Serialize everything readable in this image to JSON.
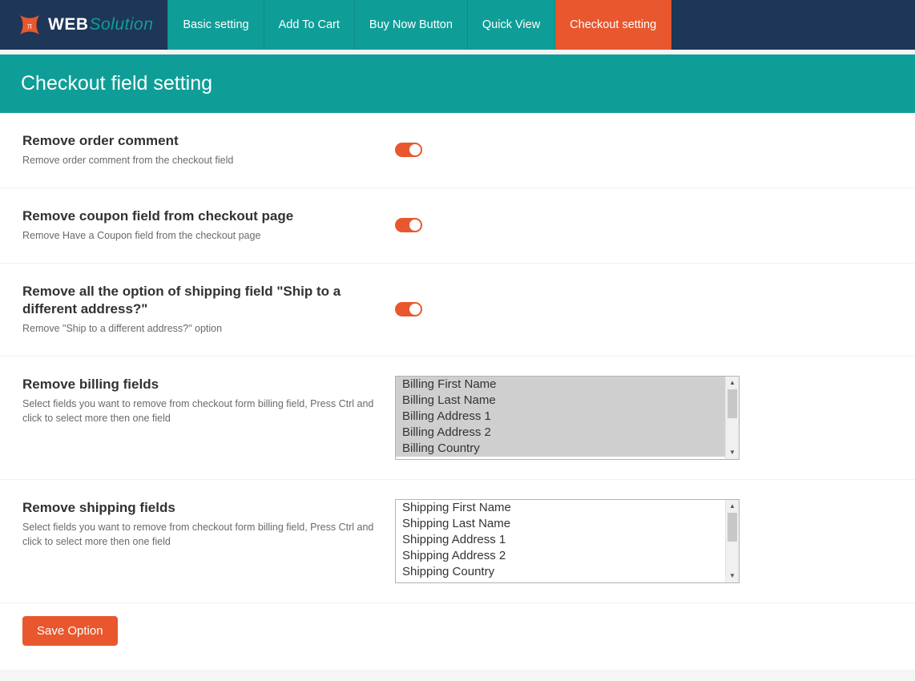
{
  "brand": {
    "web": "WEB",
    "solution": "Solution"
  },
  "colors": {
    "accent": "#e8572e",
    "primary": "#0f9e97",
    "navy": "#1e3657"
  },
  "tabs": [
    {
      "label": "Basic setting",
      "active": false
    },
    {
      "label": "Add To Cart",
      "active": false
    },
    {
      "label": "Buy Now Button",
      "active": false
    },
    {
      "label": "Quick View",
      "active": false
    },
    {
      "label": "Checkout setting",
      "active": true
    }
  ],
  "page_title": "Checkout field setting",
  "sections": [
    {
      "key": "remove_order_comment",
      "title": "Remove order comment",
      "desc": "Remove order comment from the checkout field",
      "type": "toggle",
      "value": true
    },
    {
      "key": "remove_coupon",
      "title": "Remove coupon field from checkout page",
      "desc": "Remove Have a Coupon field from the checkout page",
      "type": "toggle",
      "value": true
    },
    {
      "key": "remove_ship_diff",
      "title": "Remove all the option of shipping field \"Ship to a different address?\"",
      "desc": "Remove \"Ship to a different address?\" option",
      "type": "toggle",
      "value": true
    },
    {
      "key": "remove_billing_fields",
      "title": "Remove billing fields",
      "desc": "Select fields you want to remove from checkout form billing field, Press Ctrl and click to select more then one field",
      "type": "multiselect",
      "all_selected": true,
      "options": [
        "Billing First Name",
        "Billing Last Name",
        "Billing Address 1",
        "Billing Address 2",
        "Billing Country"
      ]
    },
    {
      "key": "remove_shipping_fields",
      "title": "Remove shipping fields",
      "desc": "Select fields you want to remove from checkout form billing field, Press Ctrl and click to select more then one field",
      "type": "multiselect",
      "all_selected": false,
      "options": [
        "Shipping First Name",
        "Shipping Last Name",
        "Shipping Address 1",
        "Shipping Address 2",
        "Shipping Country"
      ]
    }
  ],
  "save_label": "Save Option"
}
